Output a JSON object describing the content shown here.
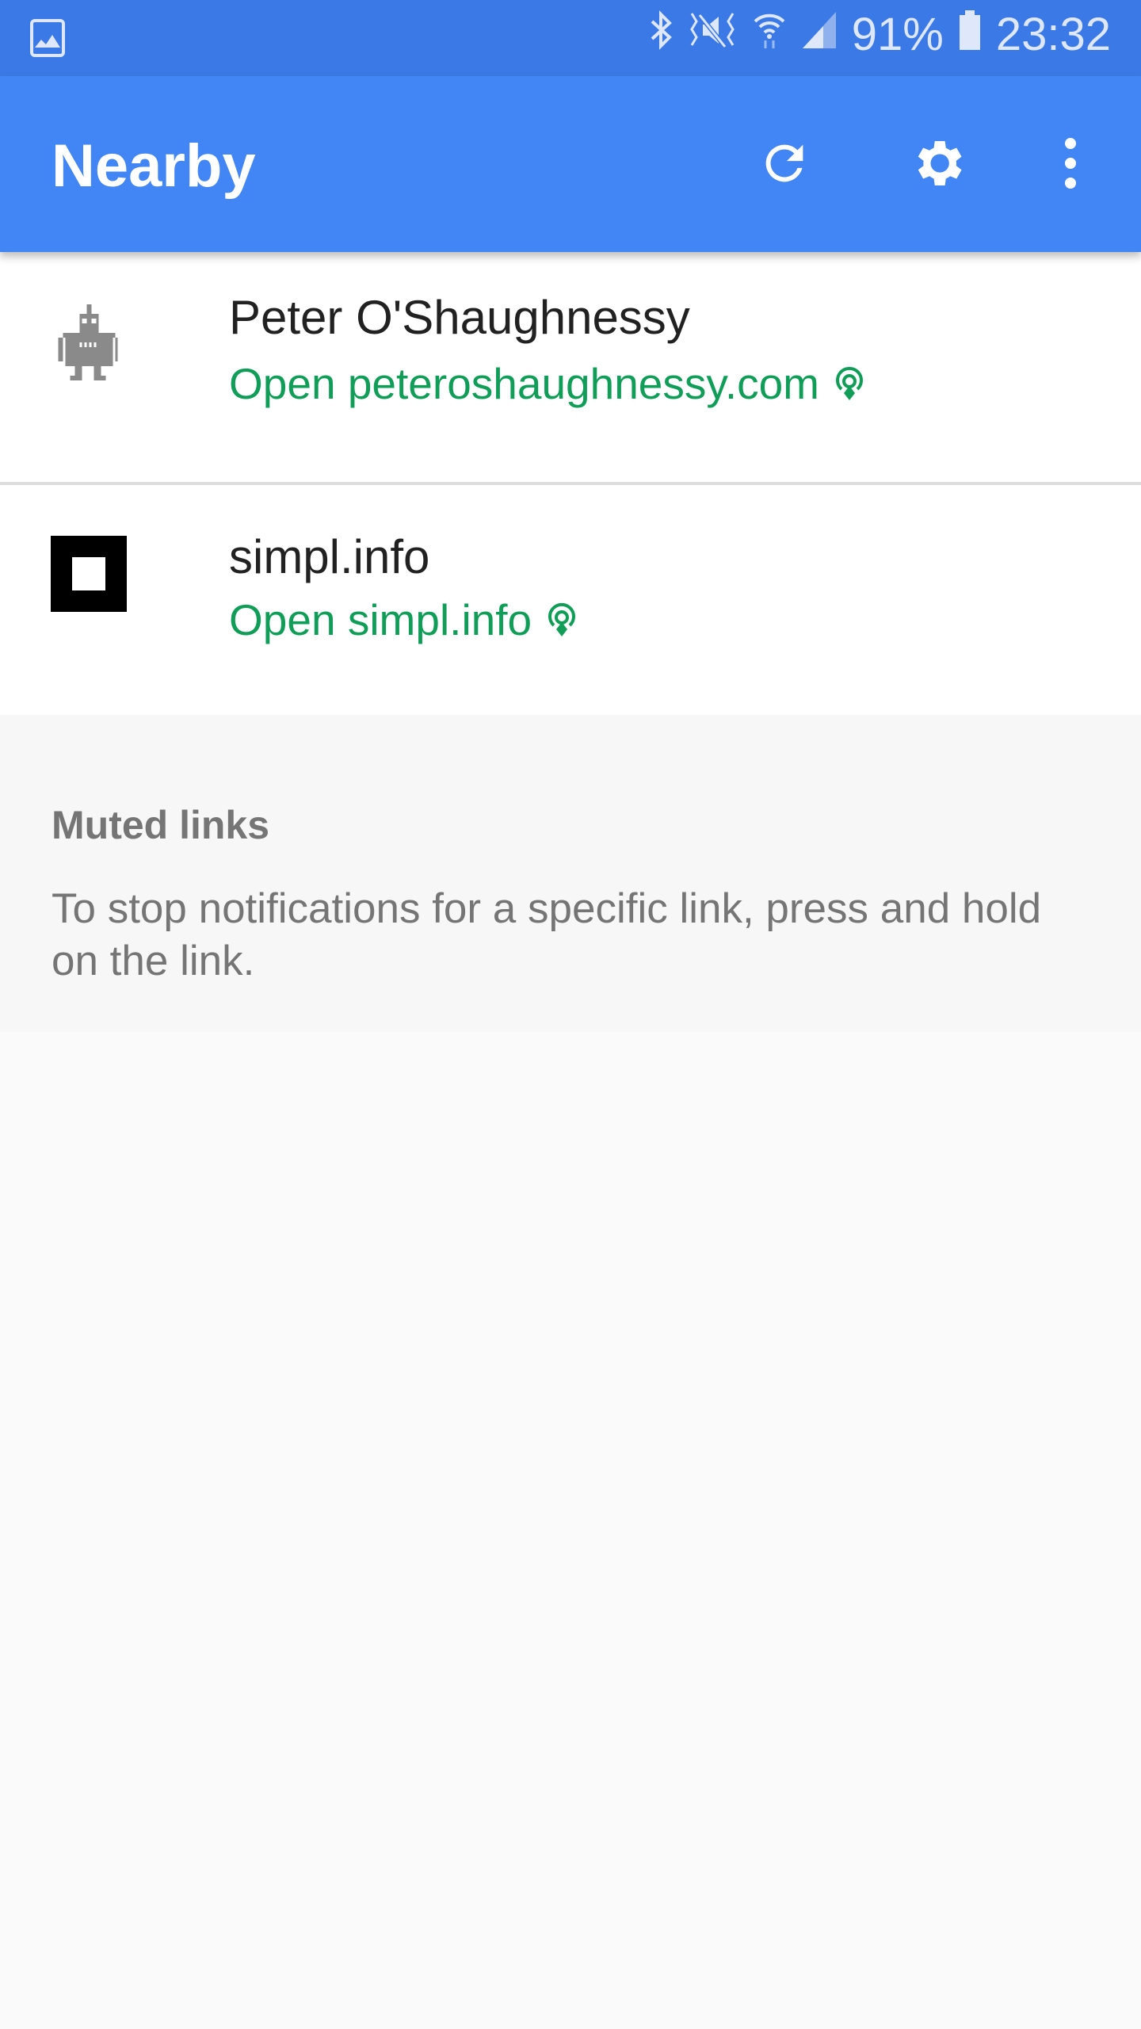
{
  "status_bar": {
    "battery": "91%",
    "time": "23:32"
  },
  "app_bar": {
    "title": "Nearby",
    "actions": [
      "refresh-icon",
      "gear-icon",
      "more-vert-icon"
    ]
  },
  "links": [
    {
      "title": "Peter O'Shaughnessy",
      "link_text": "Open peteroshaughnessy.com",
      "icon": "robot-icon"
    },
    {
      "title": "simpl.info",
      "link_text": "Open simpl.info",
      "icon": "square-icon"
    }
  ],
  "muted": {
    "heading": "Muted links",
    "description": "To stop notifications for a specific link, press and hold on the link."
  },
  "colors": {
    "status_bar": "#3b7ae6",
    "app_bar": "#4285f4",
    "link": "#0f9d58"
  }
}
